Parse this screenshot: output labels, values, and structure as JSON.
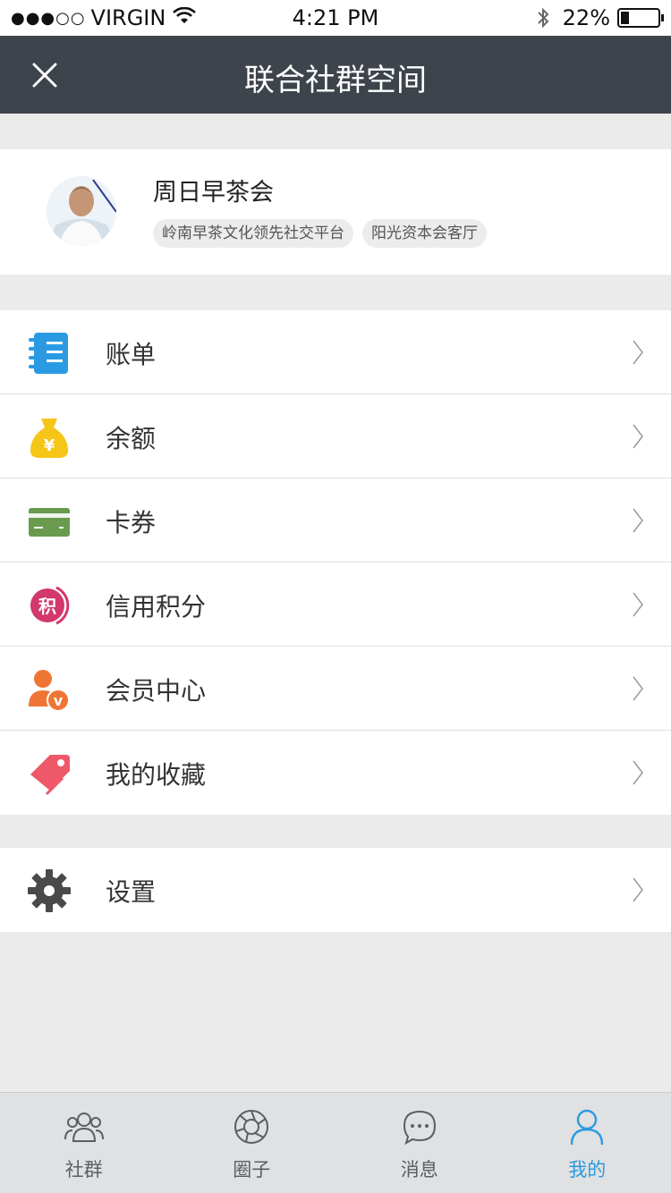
{
  "status_bar": {
    "signal": "●●●○○",
    "carrier": "VIRGIN",
    "time": "4:21 PM",
    "battery": "22%",
    "battery_level": 0.22
  },
  "nav": {
    "title": "联合社群空间",
    "close_icon": "close-icon"
  },
  "profile": {
    "name": "周日早茶会",
    "tags": [
      "岭南早茶文化领先社交平台",
      "阳光资本会客厅"
    ]
  },
  "menu": [
    {
      "label": "账单",
      "icon": "bill-icon",
      "color": "#2a9be3"
    },
    {
      "label": "余额",
      "icon": "money-bag-icon",
      "color": "#f5c518"
    },
    {
      "label": "卡券",
      "icon": "card-icon",
      "color": "#6a9a4e"
    },
    {
      "label": "信用积分",
      "icon": "credit-points-icon",
      "color": "#d2386a"
    },
    {
      "label": "会员中心",
      "icon": "member-icon",
      "color": "#ef7534"
    },
    {
      "label": "我的收藏",
      "icon": "tag-icon",
      "color": "#ee5868"
    }
  ],
  "menu_settings": {
    "label": "设置",
    "icon": "gear-icon",
    "color": "#4a4a4a"
  },
  "credit_icon_text": "积",
  "money_icon_text": "¥",
  "member_icon_text": "v",
  "tabs": [
    {
      "label": "社群",
      "icon": "community-icon",
      "active": false
    },
    {
      "label": "圈子",
      "icon": "circle-icon",
      "active": false
    },
    {
      "label": "消息",
      "icon": "message-icon",
      "active": false
    },
    {
      "label": "我的",
      "icon": "profile-icon",
      "active": true
    }
  ],
  "colors": {
    "nav_bg": "#3e444b",
    "accent": "#2b9ae0",
    "page_bg": "#ebebeb"
  }
}
